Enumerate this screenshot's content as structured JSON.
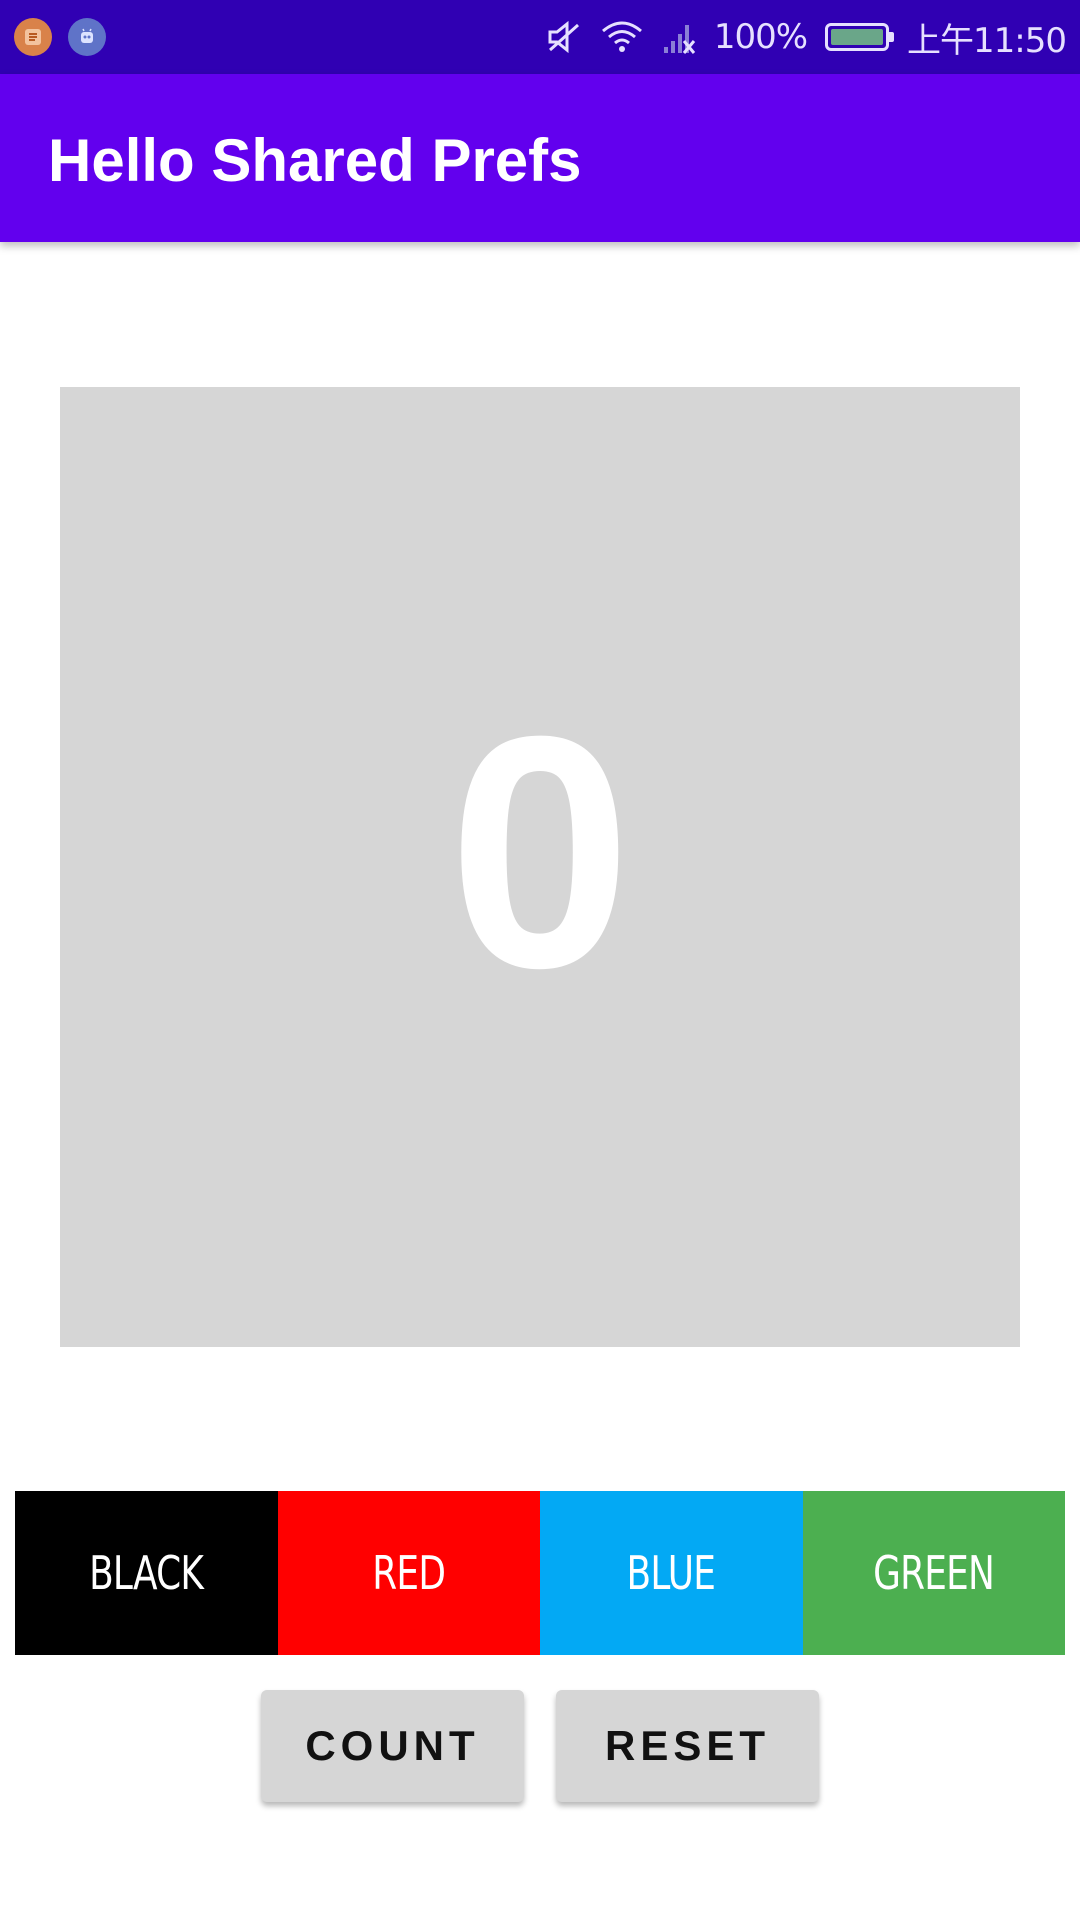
{
  "status_bar": {
    "battery_text": "100%",
    "time": "上午11:50",
    "battery_level": 1.0,
    "icons": [
      "app-notification-icon",
      "robot-notification-icon",
      "mute-icon",
      "wifi-icon",
      "no-signal-icon",
      "battery-icon"
    ]
  },
  "app_bar": {
    "title": "Hello Shared Prefs"
  },
  "counter": {
    "value": "0",
    "background_color": "#d6d6d6"
  },
  "color_buttons": [
    {
      "label": "BLACK",
      "color": "#000000"
    },
    {
      "label": "RED",
      "color": "#ff0000"
    },
    {
      "label": "BLUE",
      "color": "#03a9f4"
    },
    {
      "label": "GREEN",
      "color": "#4caf50"
    }
  ],
  "actions": {
    "count_label": "COUNT",
    "reset_label": "RESET"
  },
  "colors": {
    "status_bar": "#3000b3",
    "app_bar": "#6200ee",
    "button_gray": "#d6d6d6"
  }
}
